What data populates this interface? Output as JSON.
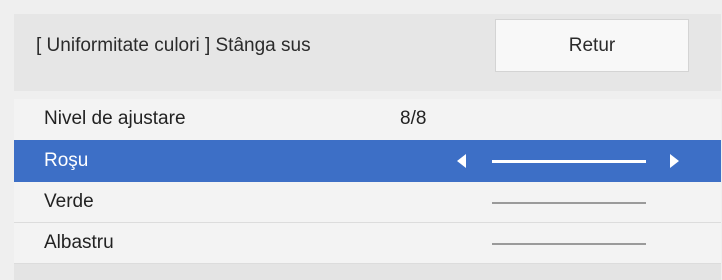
{
  "header": {
    "title": "[ Uniformitate culori ] Stânga sus",
    "return_label": "Retur"
  },
  "rows": [
    {
      "label": "Nivel de ajustare",
      "value": "8/8"
    },
    {
      "label": "Roşu",
      "selected": true
    },
    {
      "label": "Verde"
    },
    {
      "label": "Albastru"
    }
  ],
  "colors": {
    "selection": "#3d6fc6",
    "background": "#efefef"
  },
  "icons": {
    "left": "triangle-left-icon",
    "right": "triangle-right-icon"
  }
}
